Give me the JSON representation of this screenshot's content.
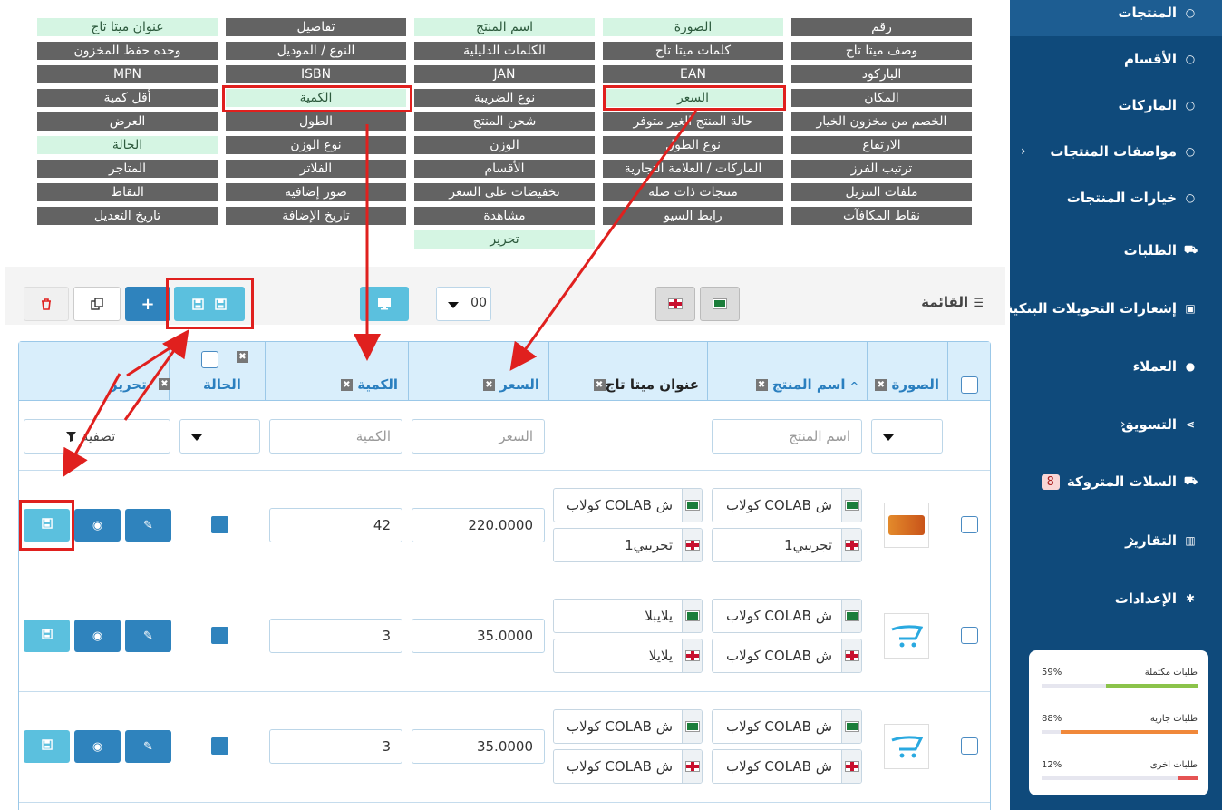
{
  "sidebar": {
    "items": [
      {
        "label": "المنتجات",
        "icon": "circle-icon"
      },
      {
        "label": "الأقسام",
        "icon": "circle-icon"
      },
      {
        "label": "الماركات",
        "icon": "circle-icon"
      },
      {
        "label": "مواصفات المنتجات",
        "icon": "circle-icon"
      },
      {
        "label": "خيارات المنتجات",
        "icon": "circle-icon"
      },
      {
        "label": "الطلبات",
        "icon": "cart-icon"
      },
      {
        "label": "إشعارات التحويلات البنكية",
        "icon": "money-icon"
      },
      {
        "label": "العملاء",
        "icon": "user-icon"
      },
      {
        "label": "التسويق",
        "icon": "share-icon"
      },
      {
        "label": "السلات المتروكة",
        "icon": "cart-icon",
        "badge": "8"
      },
      {
        "label": "التقارير",
        "icon": "bar-chart-icon"
      },
      {
        "label": "الإعدادات",
        "icon": "gear-icon"
      }
    ],
    "stats": [
      {
        "label": "طلبات مكتملة",
        "pct": "59%",
        "value": 0.59,
        "color": "#8bc34a"
      },
      {
        "label": "طلبات جارية",
        "pct": "88%",
        "value": 0.88,
        "color": "#f0883a"
      },
      {
        "label": "طلبات اخرى",
        "pct": "12%",
        "value": 0.12,
        "color": "#e55353"
      }
    ]
  },
  "columns": [
    [
      "رقم",
      "الصورة",
      "اسم المنتج",
      "تفاصيل",
      "عنوان ميتا تاج"
    ],
    [
      "وصف ميتا تاج",
      "كلمات ميتا تاج",
      "الكلمات الدليلية",
      "النوع / الموديل",
      "وحده حفظ المخزون"
    ],
    [
      "الباركود",
      "EAN",
      "JAN",
      "ISBN",
      "MPN"
    ],
    [
      "المكان",
      "السعر",
      "نوع الضريبة",
      "الكمية",
      "أقل كمية"
    ],
    [
      "الخصم من مخزون الخيار",
      "حالة المنتج الغير متوفر",
      "شحن المنتج",
      "الطول",
      "العرض"
    ],
    [
      "الارتفاع",
      "نوع الطول",
      "الوزن",
      "نوع الوزن",
      "الحالة"
    ],
    [
      "ترتيب الفرز",
      "الماركات / العلامة التجارية",
      "الأقسام",
      "الفلاتر",
      "المتاجر"
    ],
    [
      "ملفات التنزيل",
      "منتجات ذات صلة",
      "تخفيضات على السعر",
      "صور إضافية",
      "النقاط"
    ],
    [
      "نقاط المكافآت",
      "رابط السيو",
      "مشاهدة",
      "تاريخ الإضافة",
      "تاريخ التعديل"
    ],
    [
      "",
      "",
      "تحرير",
      "",
      ""
    ]
  ],
  "columns_active": [
    [
      false,
      true,
      true,
      false,
      true
    ],
    [
      false,
      false,
      false,
      false,
      false
    ],
    [
      false,
      false,
      false,
      false,
      false
    ],
    [
      false,
      true,
      false,
      true,
      false
    ],
    [
      false,
      false,
      false,
      false,
      false
    ],
    [
      false,
      false,
      false,
      false,
      true
    ],
    [
      false,
      false,
      false,
      false,
      false
    ],
    [
      false,
      false,
      false,
      false,
      false
    ],
    [
      false,
      false,
      false,
      false,
      false
    ],
    [
      false,
      false,
      true,
      false,
      false
    ]
  ],
  "toolbar": {
    "list_label": "القائمة",
    "per_page": "00"
  },
  "headers": {
    "image": "الصورة",
    "name": "اسم المنتج",
    "meta_title": "عنوان ميتا تاج",
    "price": "السعر",
    "quantity": "الكمية",
    "status": "الحالة",
    "edit": "تحرير"
  },
  "filters": {
    "name_placeholder": "اسم المنتج",
    "price_placeholder": "السعر",
    "quantity_placeholder": "الكمية",
    "filter_button": "تصفية"
  },
  "rows": [
    {
      "name_ar": "كولاب COLAB ش",
      "name_en": "تجريبي1",
      "meta_ar": "كولاب COLAB ش",
      "meta_en": "تجريبي1",
      "price": "220.0000",
      "quantity": "42",
      "image": "product-photo"
    },
    {
      "name_ar": "كولاب COLAB ش",
      "name_en": "كولاب COLAB ش",
      "meta_ar": "يلايبلا",
      "meta_en": "يلايلا",
      "price": "35.0000",
      "quantity": "3",
      "image": "cart-placeholder"
    },
    {
      "name_ar": "كولاب COLAB ش",
      "name_en": "كولاب COLAB ش",
      "meta_ar": "كولاب COLAB ش",
      "meta_en": "كولاب COLAB ش",
      "price": "35.0000",
      "quantity": "3",
      "image": "cart-placeholder"
    }
  ]
}
